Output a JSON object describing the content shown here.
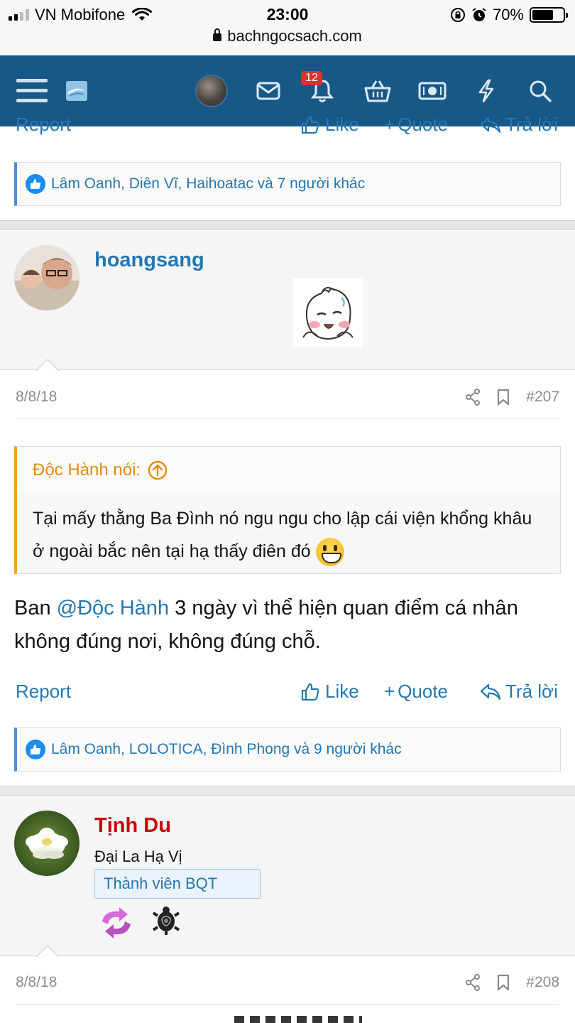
{
  "status_bar": {
    "carrier": "VN Mobifone",
    "time": "23:00",
    "battery": "70%",
    "battery_level": 0.7,
    "url": "bachngocsach.com"
  },
  "nav": {
    "notifications_count": "12"
  },
  "top_actions": {
    "report": "Report",
    "like": "Like",
    "quote": "Quote",
    "reply": "Trả lời"
  },
  "reactions_1": "Lâm Oanh, Diên Vĩ, Haihoatac và 7 người khác",
  "post_207": {
    "author": "hoangsang",
    "date": "8/8/18",
    "number": "#207",
    "quote_author": "Độc Hành nói:",
    "quote_text": "Tại mấy thằng Ba Đình nó ngu ngu cho lập cái viện khổng khâu ở ngoài bắc nên tại hạ thấy điên đó",
    "text_before": "Ban ",
    "mention": "@Độc Hành",
    "text_after": " 3 ngày vì thể hiện quan điểm cá nhân không đúng nơi, không đúng chỗ.",
    "actions": {
      "report": "Report",
      "like": "Like",
      "quote": "Quote",
      "reply": "Trả lời"
    },
    "reactions": "Lâm Oanh, LOLOTICA, Đình Phong và 9 người khác"
  },
  "post_208": {
    "author": "Tịnh Du",
    "author_color": "#cc0000",
    "role": "Đại La Hạ Vị",
    "badge": "Thành viên BQT",
    "date": "8/8/18",
    "number": "#208"
  },
  "colors": {
    "nav_bg": "#185886",
    "link": "#2577b1",
    "quote_accent": "#f0a020"
  }
}
